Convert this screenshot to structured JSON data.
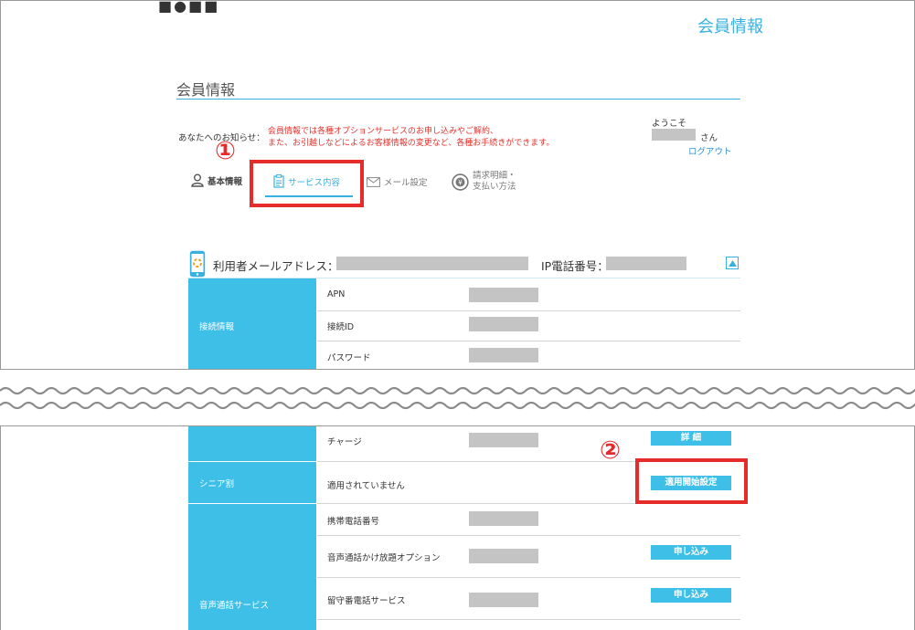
{
  "header": {
    "logo_fragment": "■●■■",
    "title": "会員情報"
  },
  "page": {
    "section_title": "会員情報",
    "notice_label": "あなたへのお知らせ：",
    "notice_line1": "会員情報では各種オプションサービスのお申し込みやご解約、",
    "notice_line2": "また、お引越しなどによるお客様情報の変更など、各種お手続きができます。",
    "welcome": "ようこそ",
    "san": "さん",
    "logout": "ログアウト"
  },
  "tabs": {
    "basic": "基本情報",
    "service": "サービス内容",
    "mail": "メール設定",
    "billing_line1": "請求明細・",
    "billing_line2": "支払い方法"
  },
  "annotations": {
    "step1": "①",
    "step2": "②",
    "highlight_color": "#e62b2b"
  },
  "line": {
    "user_email_label": "利用者メールアドレス：",
    "ip_label": "IP電話番号："
  },
  "table_top": {
    "category": "接続情報",
    "rows": [
      "APN",
      "接続ID",
      "パスワード"
    ]
  },
  "table_bottom": {
    "charge_label": "チャージ",
    "charge_button": "詳 細",
    "senior_category": "シニア割",
    "senior_status": "適用されていません",
    "senior_button": "適用開始設定",
    "voice_category": "音声通話サービス",
    "voice_rows": [
      {
        "label": "携帯電話番号"
      },
      {
        "label": "音声通話かけ放題オプション",
        "button": "申し込み"
      },
      {
        "label": "留守番電話サービス",
        "button": "申し込み"
      }
    ]
  },
  "colors": {
    "accent": "#38b1e0",
    "category_bg": "#3dbfe8",
    "notice_red": "#e0332d",
    "mask_gray": "#c4c4c4"
  }
}
